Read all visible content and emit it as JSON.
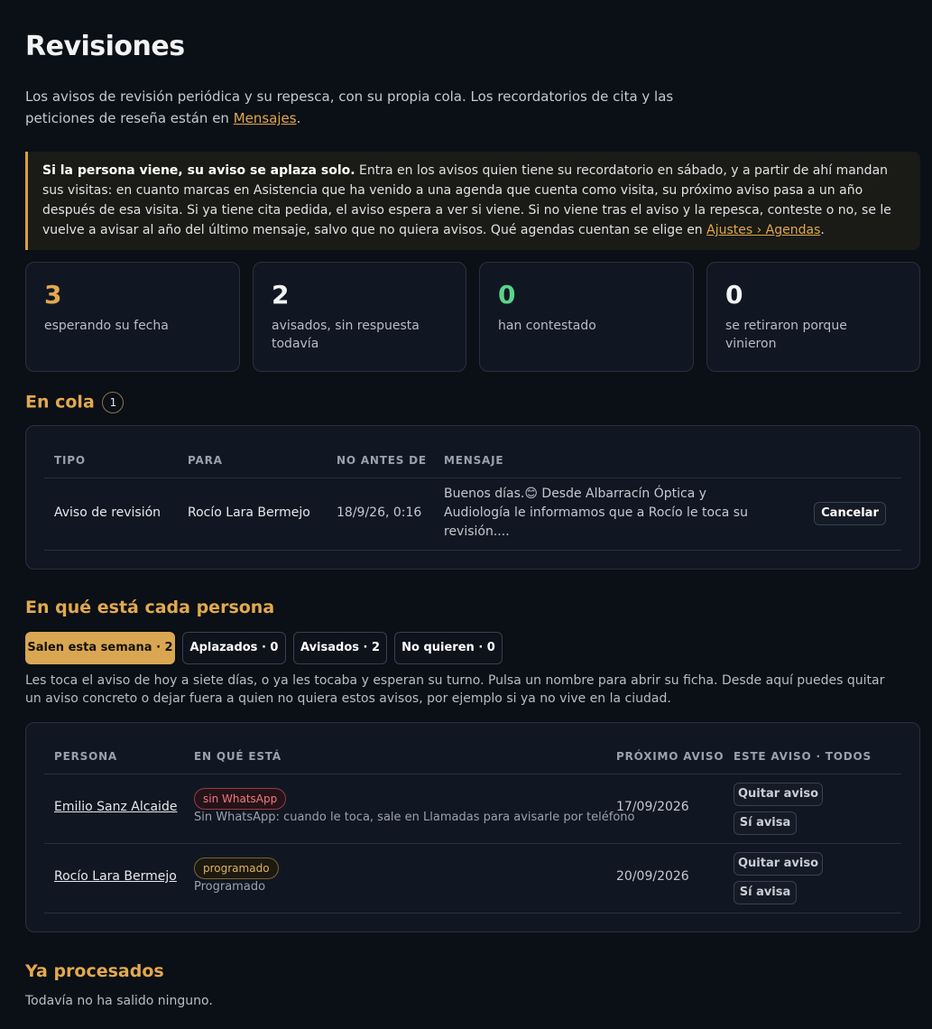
{
  "page": {
    "title": "Revisiones",
    "intro_text": "Los avisos de revisión periódica y su repesca, con su propia cola. Los recordatorios de cita y las peticiones de reseña están en ",
    "intro_link": "Mensajes",
    "intro_end": "."
  },
  "callout": {
    "bold": "Si la persona viene, su aviso se aplaza solo.",
    "text": " Entra en los avisos quien tiene su recordatorio en sábado, y a partir de ahí mandan sus visitas: en cuanto marcas en Asistencia que ha venido a una agenda que cuenta como visita, su próximo aviso pasa a un año después de esa visita. Si ya tiene cita pedida, el aviso espera a ver si viene. Si no viene tras el aviso y la repesca, conteste o no, se le vuelve a avisar al año del último mensaje, salvo que no quiera avisos. Qué agendas cuentan se elige en ",
    "link": "Ajustes › Agendas",
    "end": "."
  },
  "stats": [
    {
      "value": "3",
      "label": "esperando su fecha",
      "color": "#e2a94d"
    },
    {
      "value": "2",
      "label": "avisados, sin respuesta todavía",
      "color": "#f2f3f5"
    },
    {
      "value": "0",
      "label": "han contestado",
      "color": "#5bd48a"
    },
    {
      "value": "0",
      "label": "se retiraron porque vinieron",
      "color": "#f2f3f5"
    }
  ],
  "queue": {
    "title": "En cola",
    "count": "1",
    "headers": {
      "tipo": "TIPO",
      "para": "PARA",
      "no_antes": "NO ANTES DE",
      "mensaje": "MENSAJE"
    },
    "rows": [
      {
        "tipo": "Aviso de revisión",
        "para": "Rocío Lara Bermejo",
        "no_antes": "18/9/26, 0:16",
        "mensaje": "Buenos días.😊 Desde Albarracín Óptica y Audiología le informamos que a Rocío le toca su revisión....",
        "action": "Cancelar"
      }
    ]
  },
  "people": {
    "title": "En qué está cada persona",
    "tabs": [
      {
        "label": "Salen esta semana · 2",
        "active": true
      },
      {
        "label": "Aplazados · 0",
        "active": false
      },
      {
        "label": "Avisados · 2",
        "active": false
      },
      {
        "label": "No quieren · 0",
        "active": false
      }
    ],
    "description": "Les toca el aviso de hoy a siete días, o ya les tocaba y esperan su turno. Pulsa un nombre para abrir su ficha. Desde aquí puedes quitar un aviso concreto o dejar fuera a quien no quiera estos avisos, por ejemplo si ya no vive en la ciudad.",
    "headers": {
      "persona": "PERSONA",
      "estado": "EN QUÉ ESTÁ",
      "proximo": "PRÓXIMO AVISO",
      "acciones": "ESTE AVISO · TODOS"
    },
    "rows": [
      {
        "persona": "Emilio Sanz Alcaide",
        "badge": "sin WhatsApp",
        "badge_kind": "red",
        "detalle": "Sin WhatsApp: cuando le toca, sale en Llamadas para avisarle por teléfono",
        "proximo": "17/09/2026",
        "btn_quitar": "Quitar aviso",
        "btn_si": "Sí avisa"
      },
      {
        "persona": "Rocío Lara Bermejo",
        "badge": "programado",
        "badge_kind": "amber",
        "detalle": "Programado",
        "proximo": "20/09/2026",
        "btn_quitar": "Quitar aviso",
        "btn_si": "Sí avisa"
      }
    ]
  },
  "processed": {
    "title": "Ya procesados",
    "empty": "Todavía no ha salido ninguno."
  }
}
